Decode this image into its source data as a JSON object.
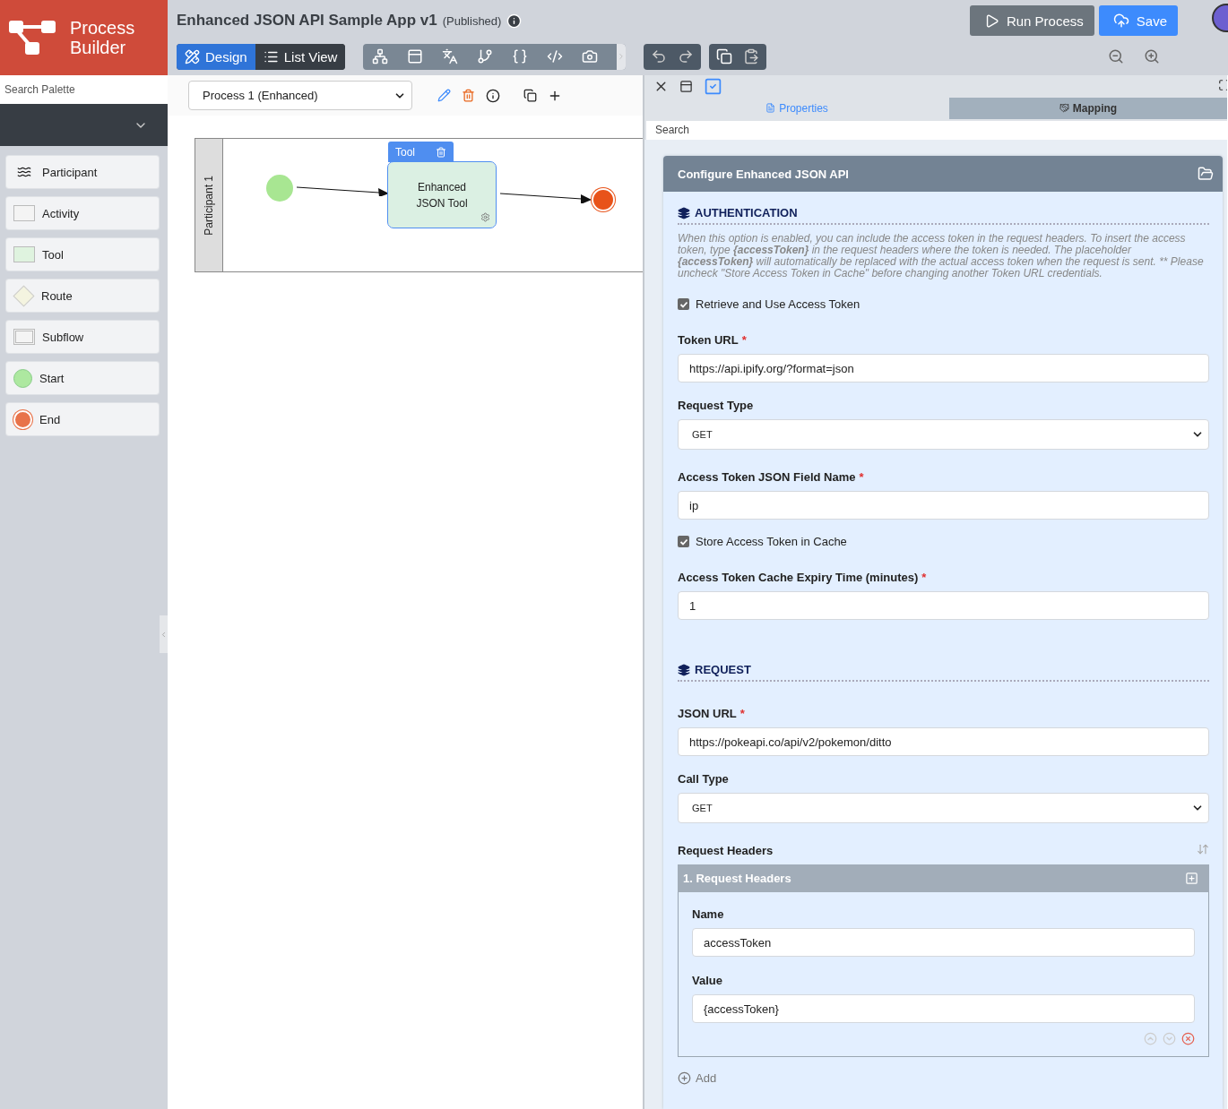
{
  "logo": {
    "text": "Process Builder"
  },
  "header": {
    "title": "Enhanced JSON API Sample App v1",
    "status": "(Published)",
    "view_tabs": [
      {
        "label": "Design",
        "kind": "design",
        "selected": true
      },
      {
        "label": "List View",
        "kind": "list",
        "selected": false
      }
    ],
    "actions": [
      {
        "label": "Run Process",
        "kind": "run"
      },
      {
        "label": "Save",
        "kind": "save"
      }
    ]
  },
  "palette": {
    "search_placeholder": "Search Palette",
    "items": [
      {
        "label": "Participant",
        "kind": "participant"
      },
      {
        "label": "Activity",
        "kind": "activity"
      },
      {
        "label": "Tool",
        "kind": "tool"
      },
      {
        "label": "Route",
        "kind": "route"
      },
      {
        "label": "Subflow",
        "kind": "subflow"
      },
      {
        "label": "Start",
        "kind": "start"
      },
      {
        "label": "End",
        "kind": "end"
      }
    ]
  },
  "canvas": {
    "process": "Process 1 (Enhanced)",
    "lane": "Participant 1",
    "node": {
      "tag": "Tool",
      "label": "Enhanced JSON Tool",
      "selected": true
    }
  },
  "properties_panel": {
    "tabs": [
      {
        "label": "Properties",
        "kind": "properties",
        "selected": true
      },
      {
        "label": "Mapping",
        "kind": "mapping",
        "selected": false
      }
    ],
    "search_placeholder": "Search",
    "form_title": "Configure Enhanced JSON API",
    "sections": [
      {
        "heading": "AUTHENTICATION",
        "description": "When this option is enabled, you can include the access token in the request headers. To insert the access token, type **{accessToken}** in the request headers where the token is needed. The placeholder **{accessToken}** will automatically be replaced with the actual access token when the request is sent. ** Please uncheck \"Store Access Token in Cache\" before changing another Token URL credentials.",
        "fields": [
          {
            "kind": "checkbox",
            "label": "Retrieve and Use Access Token",
            "checked": true
          },
          {
            "kind": "text",
            "label": "Token URL",
            "required_mark": "*",
            "value": "https://api.ipify.org/?format=json"
          },
          {
            "kind": "select",
            "label": "Request Type",
            "value": "GET"
          },
          {
            "kind": "text",
            "label": "Access Token JSON Field Name",
            "required_mark": "*",
            "value": "ip"
          },
          {
            "kind": "checkbox",
            "label": "Store Access Token in Cache",
            "checked": true
          },
          {
            "kind": "text",
            "label": "Access Token Cache Expiry Time (minutes)",
            "required_mark": "*",
            "value": "1"
          }
        ]
      },
      {
        "heading": "REQUEST",
        "fields": [
          {
            "kind": "text",
            "label": "JSON URL",
            "required_mark": "*",
            "value": "https://pokeapi.co/api/v2/pokemon/ditto"
          },
          {
            "kind": "select",
            "label": "Call Type",
            "value": "GET"
          },
          {
            "kind": "grid",
            "label": "Request Headers",
            "add_label": "Add",
            "rows": [
              {
                "title": "1. Request Headers",
                "fields": [
                  {
                    "label": "Name",
                    "value": "accessToken"
                  },
                  {
                    "label": "Value",
                    "value": "{accessToken}"
                  }
                ]
              }
            ]
          }
        ]
      }
    ]
  }
}
